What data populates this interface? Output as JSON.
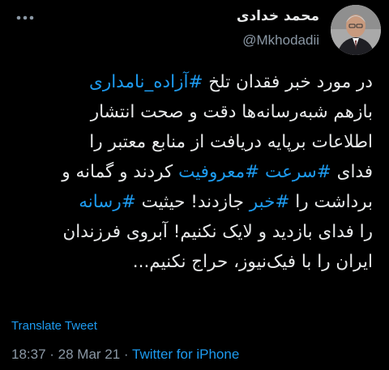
{
  "author": {
    "display_name": "محمد خدادی",
    "handle": "@Mkhodadii"
  },
  "tweet": {
    "lines": [
      [
        {
          "t": "در مورد خبر فقدان تلخ "
        },
        {
          "t": "#آزاده_نامداری",
          "tag": true
        }
      ],
      [
        {
          "t": "بازهم شبه‌رسانه‌ها دقت و صحت انتشار"
        }
      ],
      [
        {
          "t": "اطلاعات برپایه دریافت از منابع معتبر را"
        }
      ],
      [
        {
          "t": "فدای "
        },
        {
          "t": "#سرعت",
          "tag": true
        },
        {
          "t": " "
        },
        {
          "t": "#معروفیت",
          "tag": true
        },
        {
          "t": " کردند و گمانه و"
        }
      ],
      [
        {
          "t": "برداشت را "
        },
        {
          "t": "#خبر",
          "tag": true
        },
        {
          "t": " جازدند! حیثیت "
        },
        {
          "t": "#رسانه",
          "tag": true
        }
      ],
      [
        {
          "t": "را فدای بازدید و لایک نکنیم! آبروی فرزندان"
        }
      ],
      [
        {
          "t": "ایران را با فیک‌نیوز، حراج نکنیم..."
        }
      ]
    ]
  },
  "translate_label": "Translate Tweet",
  "meta": {
    "time": "18:37",
    "separator": " · ",
    "date": "28 Mar 21",
    "source": "Twitter for iPhone"
  },
  "colors": {
    "background": "#000000",
    "text": "#e7e9ea",
    "secondary": "#8b98a5",
    "accent": "#1d9bf0"
  },
  "icons": {
    "more": "more-dots-icon",
    "avatar": "profile-photo"
  }
}
